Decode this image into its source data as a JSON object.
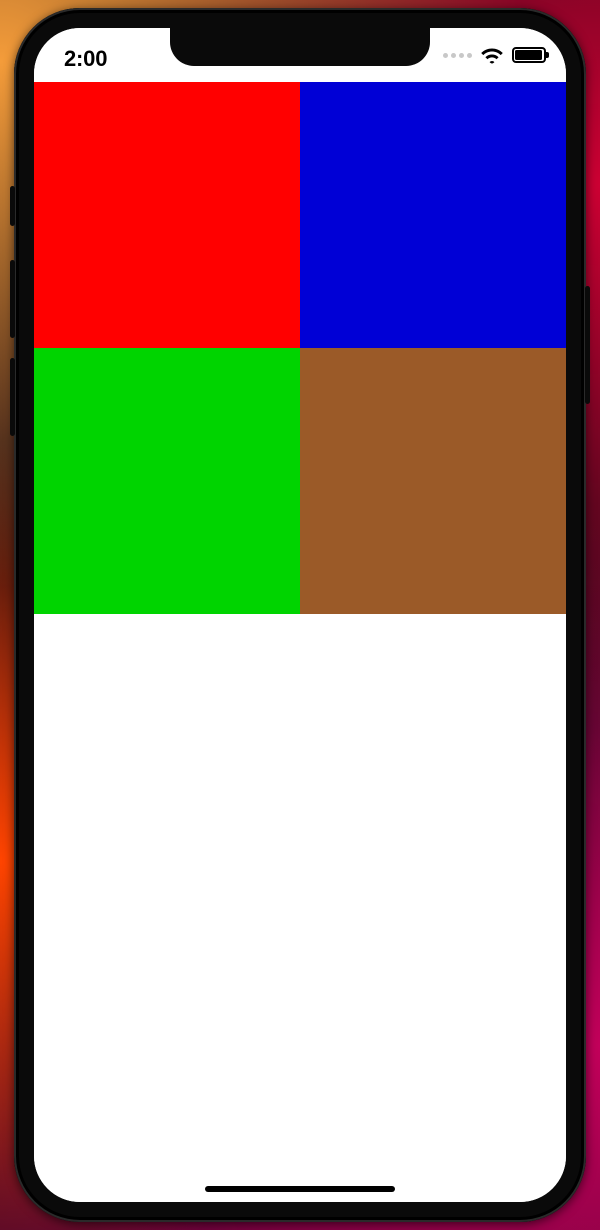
{
  "status_bar": {
    "time": "2:00",
    "cellular_dots": [
      "dim",
      "dim",
      "dim",
      "dim"
    ],
    "wifi_level": 3,
    "battery_pct": 95
  },
  "tiles": [
    {
      "name": "red",
      "color": "#ff0000"
    },
    {
      "name": "blue",
      "color": "#0000d6"
    },
    {
      "name": "green",
      "color": "#00d400"
    },
    {
      "name": "brown",
      "color": "#9b5a28"
    }
  ]
}
